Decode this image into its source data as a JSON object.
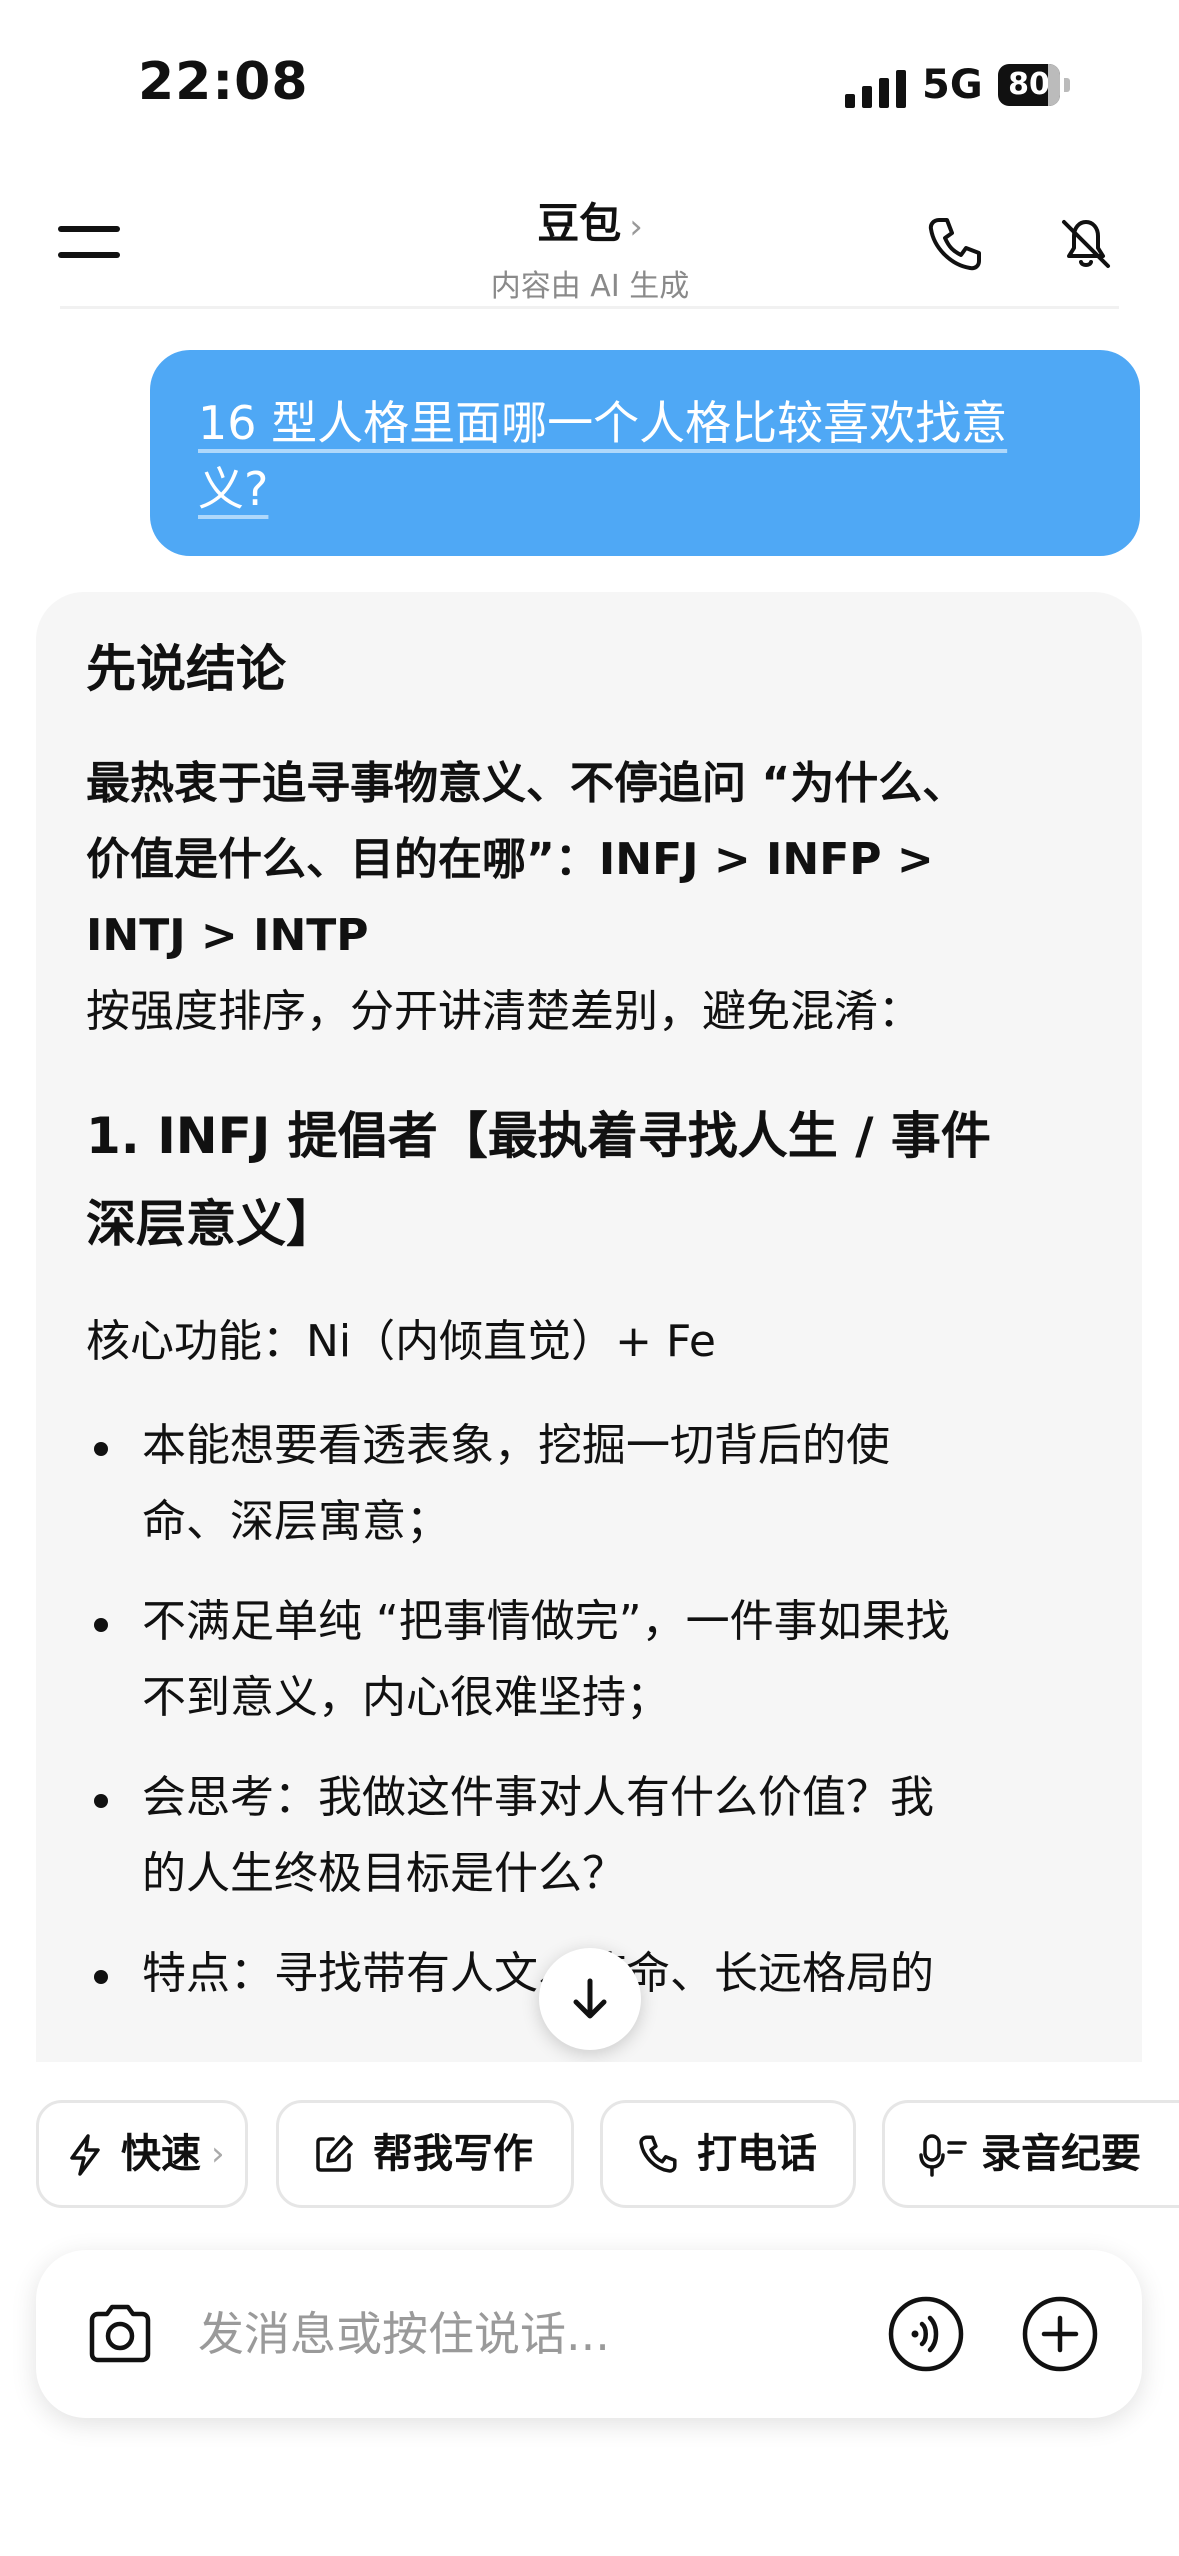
{
  "status_bar": {
    "time": "22:08",
    "network": "5G",
    "battery": "80"
  },
  "header": {
    "title": "豆包",
    "title_chevron": "›",
    "subtitle": "内容由 AI 生成"
  },
  "user_message": {
    "line1": "16 型人格里面哪一个人格比较喜欢找意",
    "line2": "义?"
  },
  "reply": {
    "heading": "先说结论",
    "lead_lines": [
      "最热衷于追寻事物意义、不停追问 “为什么、",
      "价值是什么、目的在哪”：INFJ > INFP >",
      "INTJ > INTP"
    ],
    "note": "按强度排序，分开讲清楚差别，避免混淆：",
    "section1_title_lines": [
      "1. INFJ 提倡者【最执着寻找人生 / 事件",
      "深层意义】"
    ],
    "core_function": "核心功能：Ni（内倾直觉）+ Fe",
    "bullets": [
      {
        "line1": "本能想要看透表象，挖掘一切背后的使",
        "line2": "命、深层寓意；"
      },
      {
        "line1": "不满足单纯 “把事情做完”，一件事如果找",
        "line2": "不到意义，内心很难坚持；"
      },
      {
        "line1": "会思考：我做这件事对人有什么价值？我",
        "line2": "的人生终极目标是什么？"
      },
      {
        "line1": "特点：寻找带有人文、使命、长远格局的",
        "line2": ""
      }
    ]
  },
  "quick_actions": [
    {
      "label": "快速",
      "chevron": "›",
      "icon": "lightning-icon"
    },
    {
      "label": "帮我写作",
      "icon": "edit-icon"
    },
    {
      "label": "打电话",
      "icon": "phone-icon"
    },
    {
      "label": "录音纪要",
      "icon": "mic-icon"
    }
  ],
  "input": {
    "placeholder": "发消息或按住说话..."
  },
  "colors": {
    "user_bubble": "#4fa8f5",
    "reply_bg": "#f6f6f6"
  }
}
